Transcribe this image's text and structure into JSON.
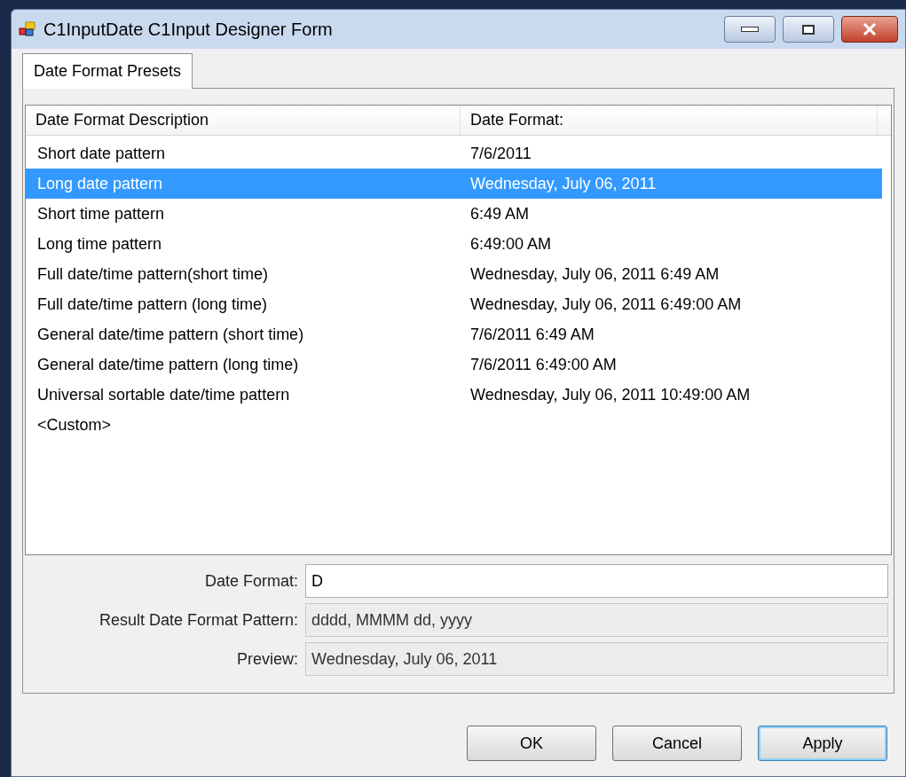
{
  "window": {
    "title": "C1InputDate C1Input Designer Form"
  },
  "tabs": [
    {
      "label": "Date Format Presets",
      "selected": true
    }
  ],
  "list": {
    "columns": [
      "Date Format Description",
      "Date Format:"
    ],
    "rows": [
      {
        "description": "Short date pattern",
        "format": "7/6/2011",
        "selected": false
      },
      {
        "description": "Long date pattern",
        "format": "Wednesday, July 06, 2011",
        "selected": true
      },
      {
        "description": "Short time pattern",
        "format": "6:49 AM",
        "selected": false
      },
      {
        "description": "Long time pattern",
        "format": "6:49:00 AM",
        "selected": false
      },
      {
        "description": "Full date/time pattern(short time)",
        "format": "Wednesday, July 06, 2011 6:49 AM",
        "selected": false
      },
      {
        "description": "Full date/time pattern (long time)",
        "format": "Wednesday, July 06, 2011 6:49:00 AM",
        "selected": false
      },
      {
        "description": "General date/time pattern (short time)",
        "format": "7/6/2011 6:49 AM",
        "selected": false
      },
      {
        "description": "General date/time pattern (long time)",
        "format": "7/6/2011 6:49:00 AM",
        "selected": false
      },
      {
        "description": "Universal sortable date/time pattern",
        "format": "Wednesday, July 06, 2011 10:49:00 AM",
        "selected": false
      },
      {
        "description": "<Custom>",
        "selected": false
      }
    ]
  },
  "fields": [
    {
      "label": "Date Format:",
      "value": "D",
      "disabled": false
    },
    {
      "label": "Result Date Format Pattern:",
      "value": "dddd, MMMM dd, yyyy",
      "disabled": true
    },
    {
      "label": "Preview:",
      "value": "Wednesday, July 06, 2011",
      "disabled": true
    }
  ],
  "buttons": [
    {
      "label": "OK",
      "default": false
    },
    {
      "label": "Cancel",
      "default": false
    },
    {
      "label": "Apply",
      "default": true
    }
  ]
}
